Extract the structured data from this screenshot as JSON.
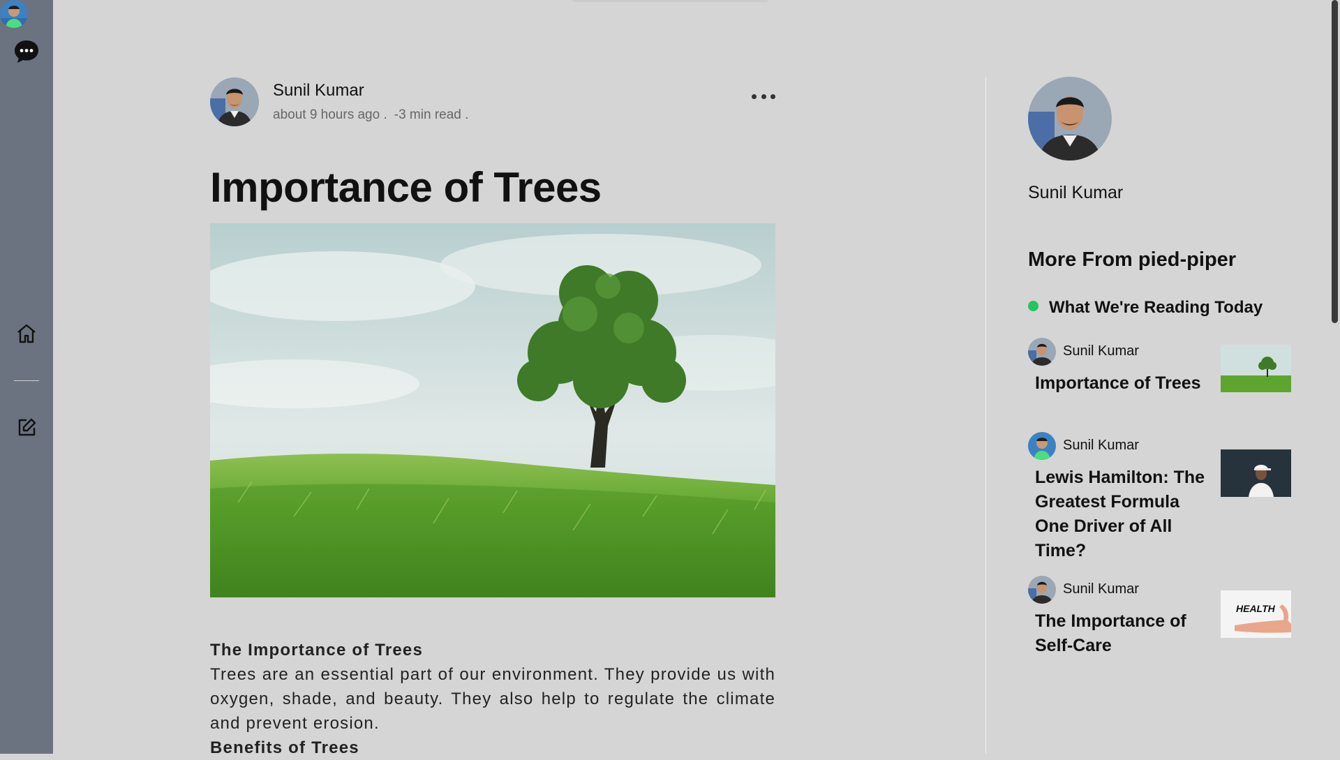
{
  "nav": {
    "icons": [
      "chat-icon",
      "home-icon",
      "edit-icon",
      "user-avatar"
    ]
  },
  "article": {
    "author": "Sunil Kumar",
    "time": "about 9 hours ago .",
    "read_time": "-3 min read .",
    "title": "Importance of Trees",
    "hero_alt": "Lone tree in a grass field",
    "sections": [
      {
        "heading": "The Importance of Trees",
        "text": "Trees are an essential part of our environment. They provide us with oxygen, shade, and beauty. They also help to regulate the climate and prevent erosion."
      },
      {
        "heading": "Benefits of Trees",
        "text": ""
      }
    ]
  },
  "sidebar": {
    "author": "Sunil Kumar",
    "more_from": "More From pied-piper",
    "reading_today": "What We're Reading Today",
    "accent": "#22c55e",
    "cards": [
      {
        "author": "Sunil Kumar",
        "title": "Importance of Trees"
      },
      {
        "author": "Sunil Kumar",
        "title": "Lewis Hamilton: The Greatest Formula One Driver of All Time?"
      },
      {
        "author": "Sunil Kumar",
        "title": "The Importance of Self-Care",
        "thumb_text": "HEALTH"
      }
    ]
  },
  "colors": {
    "background": "#d5d5d5",
    "rail": "#6b7280"
  }
}
